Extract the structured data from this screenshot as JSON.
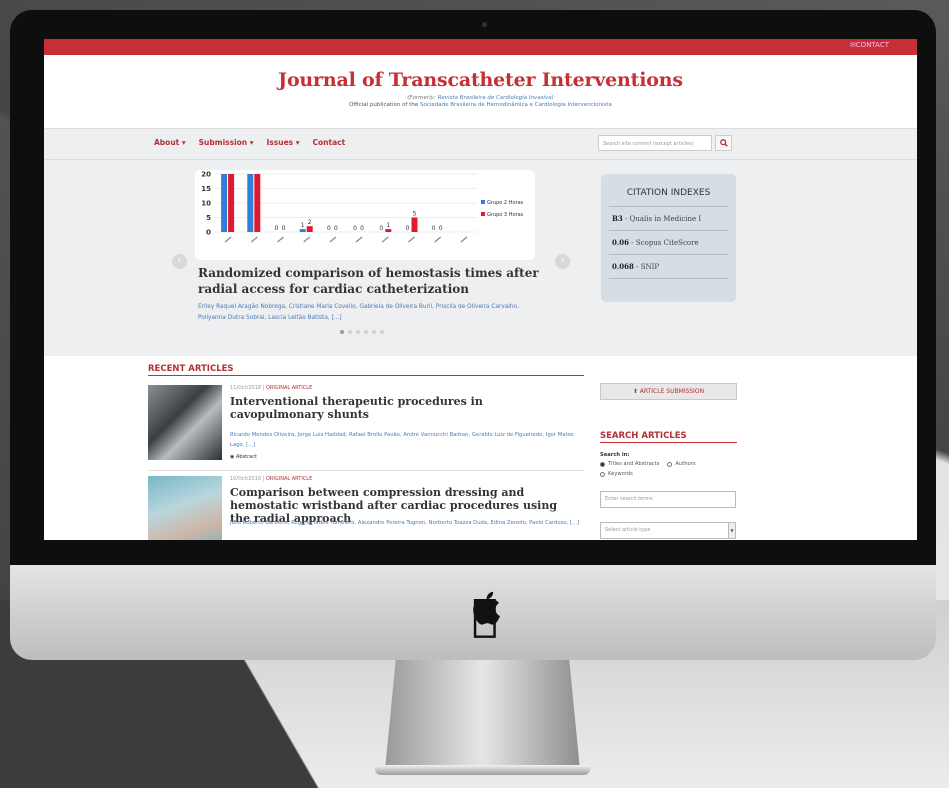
{
  "site": {
    "contact_top": "CONTACT",
    "title": "Journal of Transcatheter Interventions",
    "formerly_label": "(Formerly:",
    "formerly_name": "Revista Brasileira de Cardiologia Invasiva)",
    "official_label": "Official publication of the",
    "official_org": "Sociedade Brasileira de Hemodinâmica e Cardiologia Intervencionista"
  },
  "nav": {
    "items": [
      "About ▾",
      "Submission ▾",
      "Issues ▾",
      "Contact"
    ],
    "search_placeholder": "Search site content (except articles)"
  },
  "hero": {
    "title": "Randomized comparison of hemostasis times after radial access for cardiac catheterization",
    "authors": "Erlley Raquel Aragão Nobrega, Cristiane Maria Covello, Gabriela de Oliveira Buril, Priscila de Oliveira Carvalho, Pollyanna Dutra Sobral, Lascia Leitão Batista, [...]",
    "slides": 6,
    "active_slide": 0
  },
  "chart_data": {
    "type": "bar",
    "categories": [
      "",
      "",
      "",
      "",
      "",
      "",
      "",
      "",
      "",
      ""
    ],
    "series": [
      {
        "name": "Grupo 2 Horas",
        "values": [
          20,
          20,
          0,
          1,
          0,
          0,
          0,
          0,
          0,
          0
        ],
        "color": "#2f7fd8"
      },
      {
        "name": "Grupo 3 Horas",
        "values": [
          20,
          20,
          0,
          2,
          0,
          0,
          1,
          5,
          0,
          0
        ],
        "color": "#e0192e"
      }
    ],
    "bar_labels": [
      [
        "",
        ""
      ],
      [
        "",
        ""
      ],
      [
        "0",
        "0"
      ],
      [
        "1",
        "2"
      ],
      [
        "0",
        "0"
      ],
      [
        "0",
        "0"
      ],
      [
        "0",
        "1"
      ],
      [
        "0",
        "5"
      ],
      [
        "0",
        "0"
      ],
      [
        "",
        ""
      ]
    ],
    "yticks": [
      0,
      5,
      10,
      15,
      20
    ],
    "ylim": [
      0,
      20
    ],
    "legend": "right",
    "grid": true
  },
  "citation": {
    "title": "CITATION INDEXES",
    "rows": [
      {
        "value": "B3",
        "label": "- Qualis in Medicine I"
      },
      {
        "value": "0.06",
        "label": "- Scopus CiteScore"
      },
      {
        "value": "0.068",
        "label": "- SNIP"
      }
    ]
  },
  "recent": {
    "header": "RECENT ARTICLES",
    "articles": [
      {
        "date": "11/Oct/2018",
        "type": "ORIGINAL ARTICLE",
        "title": "Interventional therapeutic procedures in cavopulmonary shunts",
        "authors": "Ricardo Mendes Oliveira, Jorge Luis Haddad, Rafael Brollo Pavão, André Vannucchi Badran, Geraldo Luiz de Figueiredo, Igor Matos Lago, [...]",
        "abstract": "Abstract"
      },
      {
        "date": "10/Oct/2018",
        "type": "ORIGINAL ARTICLE",
        "title": "Comparison between compression dressing and hemostatic wristband after cardiac procedures using the radial approach",
        "authors": "Júlio Roberto Barbiero, Rogério Tadeu Tumelero, Alexandre Pereira Tognon, Norberto Toazza Duda, Edina Zeredo, Paolo Cardoso, [...]",
        "abstract": ""
      }
    ]
  },
  "sidebar": {
    "submission_button": "ARTICLE SUBMISSION",
    "search_header": "SEARCH ARTICLES",
    "search_in_label": "Search in:",
    "options": [
      "Titles and Abstracts",
      "Authors",
      "Keywords"
    ],
    "selected_option": "Titles and Abstracts",
    "terms_placeholder": "Enter search terms",
    "type_placeholder": "Select article type"
  }
}
